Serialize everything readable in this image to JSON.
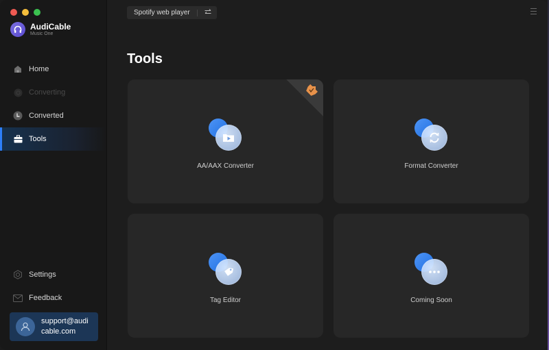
{
  "app": {
    "name": "AudiCable",
    "subtitle": "Music One"
  },
  "sidebar": {
    "items": [
      {
        "label": "Home",
        "icon": "home-icon",
        "state": "normal"
      },
      {
        "label": "Converting",
        "icon": "converting-icon",
        "state": "disabled"
      },
      {
        "label": "Converted",
        "icon": "clock-icon",
        "state": "normal"
      },
      {
        "label": "Tools",
        "icon": "toolbox-icon",
        "state": "active"
      }
    ],
    "bottom_items": [
      {
        "label": "Settings",
        "icon": "gear-icon"
      },
      {
        "label": "Feedback",
        "icon": "mail-icon"
      }
    ],
    "account": {
      "email": "support@audicable.com",
      "icon": "user-icon"
    }
  },
  "header": {
    "source_label": "Spotify web player",
    "switch_icon": "swap-arrows-icon",
    "menu_icon": "hamburger-menu-icon"
  },
  "main": {
    "title": "Tools",
    "tools": [
      {
        "label": "AA/AAX Converter",
        "icon": "video-play-icon",
        "badge": "premium-crown-icon"
      },
      {
        "label": "Format Converter",
        "icon": "refresh-icon"
      },
      {
        "label": "Tag Editor",
        "icon": "tag-icon"
      },
      {
        "label": "Coming Soon",
        "icon": "more-dots-icon"
      }
    ]
  },
  "colors": {
    "accent": "#2d7ff9",
    "active_bg": "#16324f",
    "account_bg": "#1c3656",
    "premium_badge": "#e8924a"
  }
}
